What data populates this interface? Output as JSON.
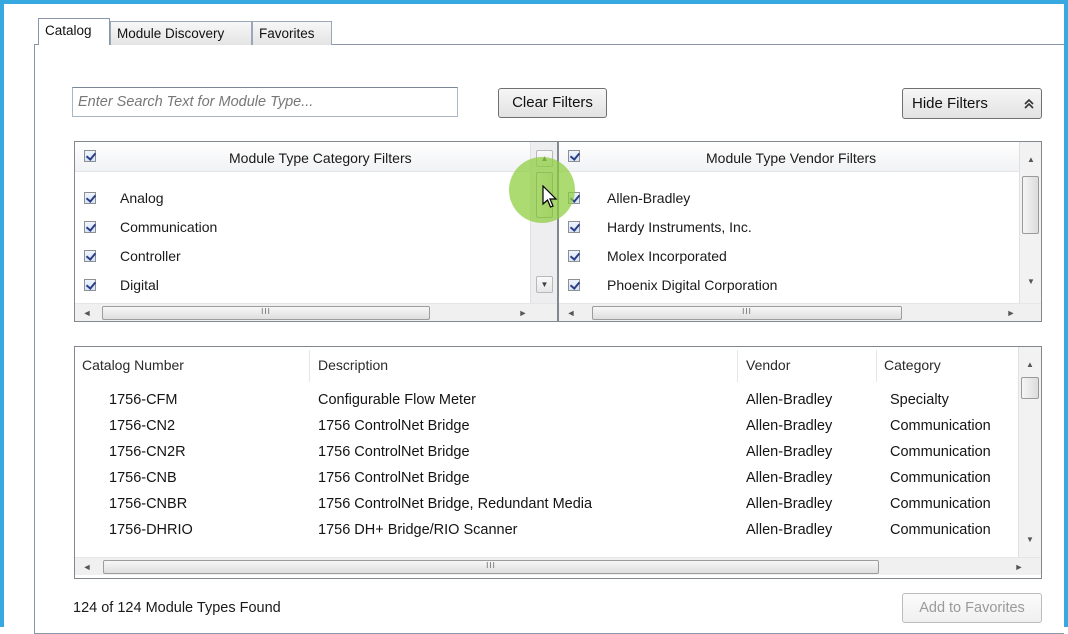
{
  "tabs": [
    {
      "label": "Catalog",
      "active": true
    },
    {
      "label": "Module Discovery",
      "active": false
    },
    {
      "label": "Favorites",
      "active": false
    }
  ],
  "search": {
    "placeholder": "Enter Search Text for Module Type..."
  },
  "buttons": {
    "clear_filters": "Clear Filters",
    "hide_filters": "Hide Filters",
    "hide_filters_icon": "double-chevron-up-icon",
    "add_to_favorites": "Add to Favorites"
  },
  "category_filters": {
    "title": "Module Type Category Filters",
    "items": [
      {
        "label": "Analog",
        "checked": true
      },
      {
        "label": "Communication",
        "checked": true
      },
      {
        "label": "Controller",
        "checked": true
      },
      {
        "label": "Digital",
        "checked": true
      }
    ]
  },
  "vendor_filters": {
    "title": "Module Type Vendor Filters",
    "items": [
      {
        "label": "Allen-Bradley",
        "checked": true
      },
      {
        "label": "Hardy Instruments, Inc.",
        "checked": true
      },
      {
        "label": "Molex Incorporated",
        "checked": true
      },
      {
        "label": "Phoenix Digital Corporation",
        "checked": true
      }
    ]
  },
  "catalog": {
    "columns": [
      "Catalog Number",
      "Description",
      "Vendor",
      "Category"
    ],
    "rows": [
      [
        "1756-CFM",
        "Configurable Flow Meter",
        "Allen-Bradley",
        "Specialty"
      ],
      [
        "1756-CN2",
        "1756 ControlNet Bridge",
        "Allen-Bradley",
        "Communication"
      ],
      [
        "1756-CN2R",
        "1756 ControlNet Bridge",
        "Allen-Bradley",
        "Communication"
      ],
      [
        "1756-CNB",
        "1756 ControlNet Bridge",
        "Allen-Bradley",
        "Communication"
      ],
      [
        "1756-CNBR",
        "1756 ControlNet Bridge, Redundant Media",
        "Allen-Bradley",
        "Communication"
      ],
      [
        "1756-DHRIO",
        "1756 DH+ Bridge/RIO Scanner",
        "Allen-Bradley",
        "Communication"
      ]
    ]
  },
  "status": {
    "text": "124  of 124 Module Types Found"
  },
  "scroll_glyphs": {
    "left": "◄",
    "right": "►",
    "up": "▲",
    "down": "▼",
    "grip": "III"
  },
  "colors": {
    "window_border": "#37a8e0",
    "click_highlight": "#8ccd3c"
  }
}
